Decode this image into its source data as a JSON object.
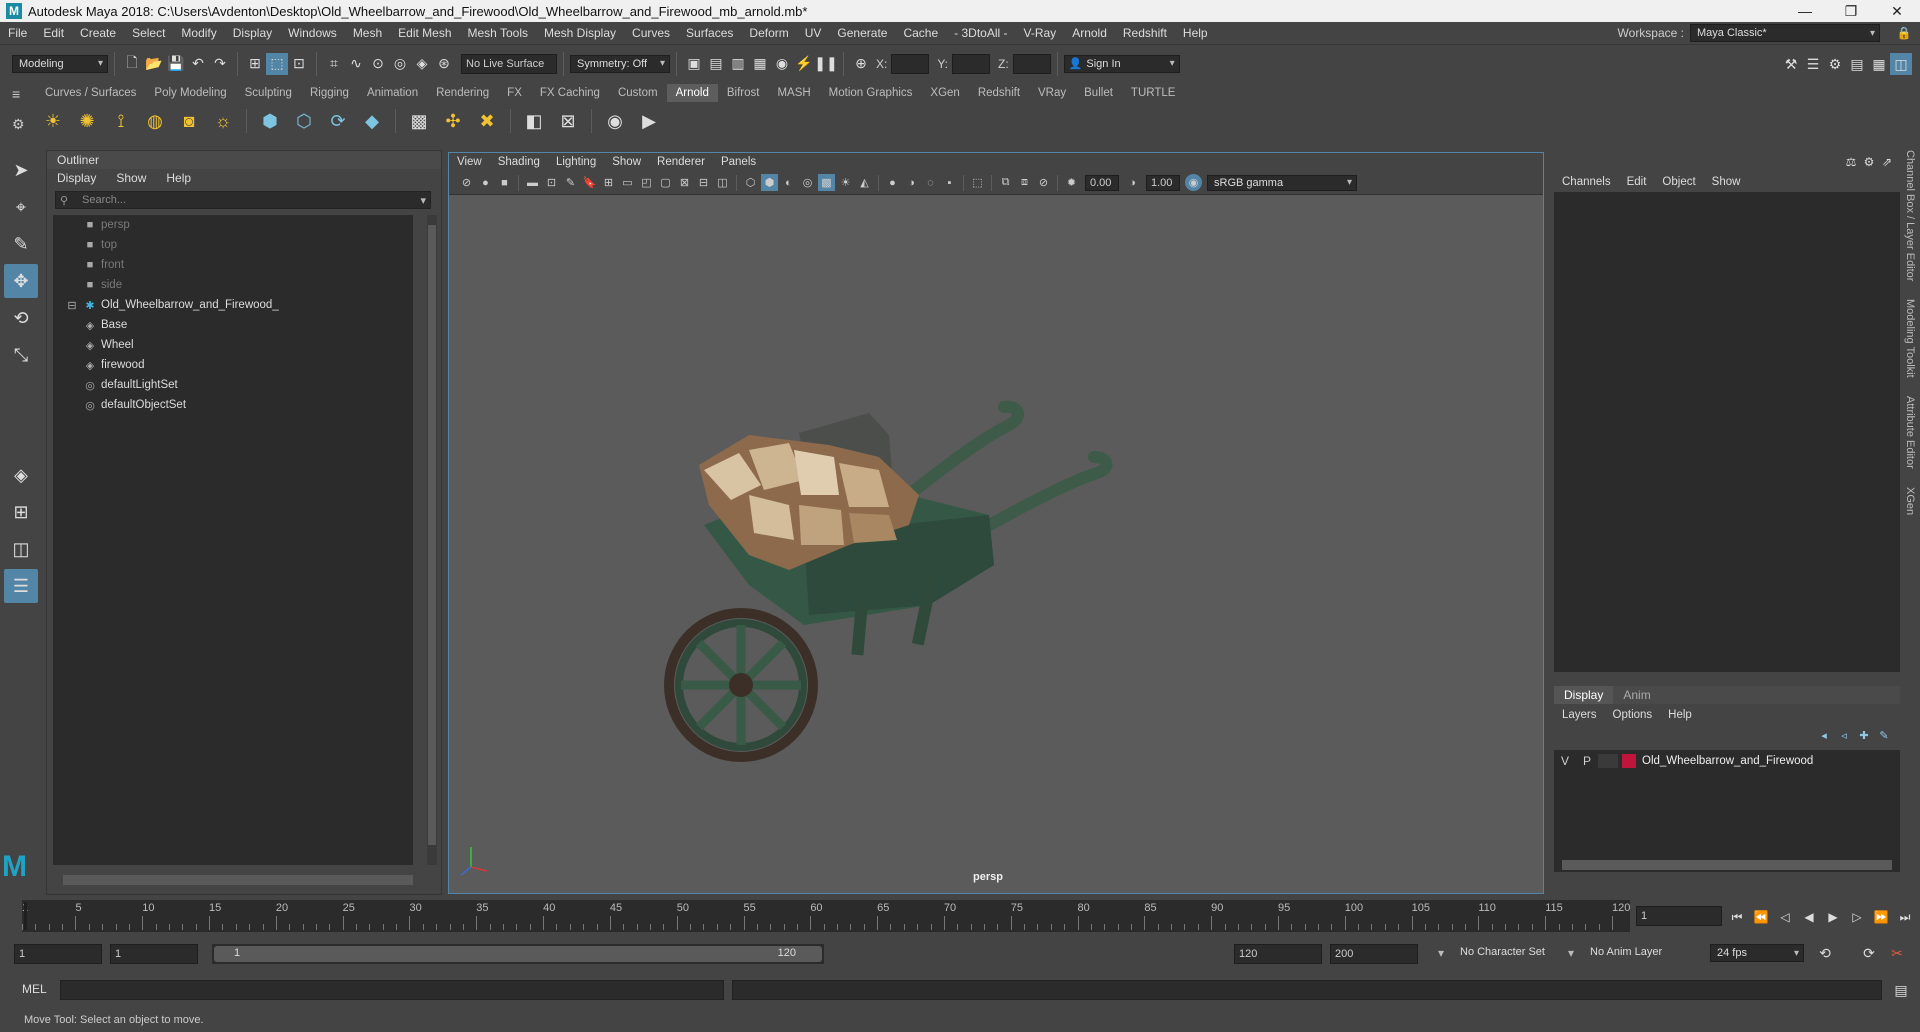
{
  "window": {
    "title": "Autodesk Maya 2018: C:\\Users\\Avdenton\\Desktop\\Old_Wheelbarrow_and_Firewood\\Old_Wheelbarrow_and_Firewood_mb_arnold.mb*",
    "logo_letter": "M",
    "minimize": "—",
    "restore": "❐",
    "close": "✕"
  },
  "menubar": {
    "items": [
      "File",
      "Edit",
      "Create",
      "Select",
      "Modify",
      "Display",
      "Windows",
      "Mesh",
      "Edit Mesh",
      "Mesh Tools",
      "Mesh Display",
      "Curves",
      "Surfaces",
      "Deform",
      "UV",
      "Generate",
      "Cache",
      "- 3DtoAll -",
      "V-Ray",
      "Arnold",
      "Redshift",
      "Help"
    ],
    "workspace_label": "Workspace :",
    "workspace_value": "Maya Classic*"
  },
  "statusline": {
    "mode": "Modeling",
    "live_surface": "No Live Surface",
    "symmetry": "Symmetry: Off",
    "x_label": "X:",
    "y_label": "Y:",
    "z_label": "Z:",
    "sign_in": "Sign In"
  },
  "shelf": {
    "tabs": [
      "Curves / Surfaces",
      "Poly Modeling",
      "Sculpting",
      "Rigging",
      "Animation",
      "Rendering",
      "FX",
      "FX Caching",
      "Custom",
      "Arnold",
      "Bifrost",
      "MASH",
      "Motion Graphics",
      "XGen",
      "Redshift",
      "VRay",
      "Bullet",
      "TURTLE"
    ],
    "active_tab": "Arnold"
  },
  "outliner": {
    "title": "Outliner",
    "menus": [
      "Display",
      "Show",
      "Help"
    ],
    "search_placeholder": "Search...",
    "items": [
      {
        "label": "persp",
        "icon": "camera-icon",
        "dim": true
      },
      {
        "label": "top",
        "icon": "camera-icon",
        "dim": true
      },
      {
        "label": "front",
        "icon": "camera-icon",
        "dim": true
      },
      {
        "label": "side",
        "icon": "camera-icon",
        "dim": true
      },
      {
        "label": "Old_Wheelbarrow_and_Firewood_",
        "icon": "group-icon",
        "dim": false
      },
      {
        "label": "Base",
        "icon": "mesh-icon",
        "dim": false
      },
      {
        "label": "Wheel",
        "icon": "mesh-icon",
        "dim": false
      },
      {
        "label": "firewood",
        "icon": "mesh-icon",
        "dim": false
      },
      {
        "label": "defaultLightSet",
        "icon": "set-icon",
        "dim": false
      },
      {
        "label": "defaultObjectSet",
        "icon": "set-icon",
        "dim": false
      }
    ]
  },
  "viewport": {
    "menus": [
      "View",
      "Shading",
      "Lighting",
      "Show",
      "Renderer",
      "Panels"
    ],
    "exposure": "0.00",
    "gamma": "1.00",
    "color_space": "sRGB gamma",
    "camera_label": "persp"
  },
  "channelbox": {
    "menus": [
      "Channels",
      "Edit",
      "Object",
      "Show"
    ],
    "side_tabs": [
      "Channel Box / Layer Editor",
      "Modeling Toolkit",
      "Attribute Editor",
      "XGen"
    ]
  },
  "layereditor": {
    "tabs": [
      "Display",
      "Anim"
    ],
    "menus": [
      "Layers",
      "Options",
      "Help"
    ],
    "layer": {
      "v": "V",
      "p": "P",
      "name": "Old_Wheelbarrow_and_Firewood",
      "color": "#c0143c"
    }
  },
  "timeslider": {
    "ticks": [
      "1",
      "5",
      "10",
      "15",
      "20",
      "25",
      "30",
      "35",
      "40",
      "45",
      "50",
      "55",
      "60",
      "65",
      "70",
      "75",
      "80",
      "85",
      "90",
      "95",
      "100",
      "105",
      "110",
      "115",
      "120"
    ],
    "current_frame": "1"
  },
  "rangeslider": {
    "start": "1",
    "playback_start": "1",
    "range_start_label": "1",
    "range_end_label": "120",
    "playback_end": "120",
    "end": "200",
    "character_set": "No Character Set",
    "anim_layer": "No Anim Layer",
    "fps": "24 fps"
  },
  "cmdline": {
    "label": "MEL"
  },
  "helpline": {
    "text": "Move Tool: Select an object to move."
  },
  "colors": {
    "accent": "#5285a6",
    "panel": "#444444",
    "field": "#2b2b2b",
    "viewport_bg": "#5b5b5b"
  }
}
